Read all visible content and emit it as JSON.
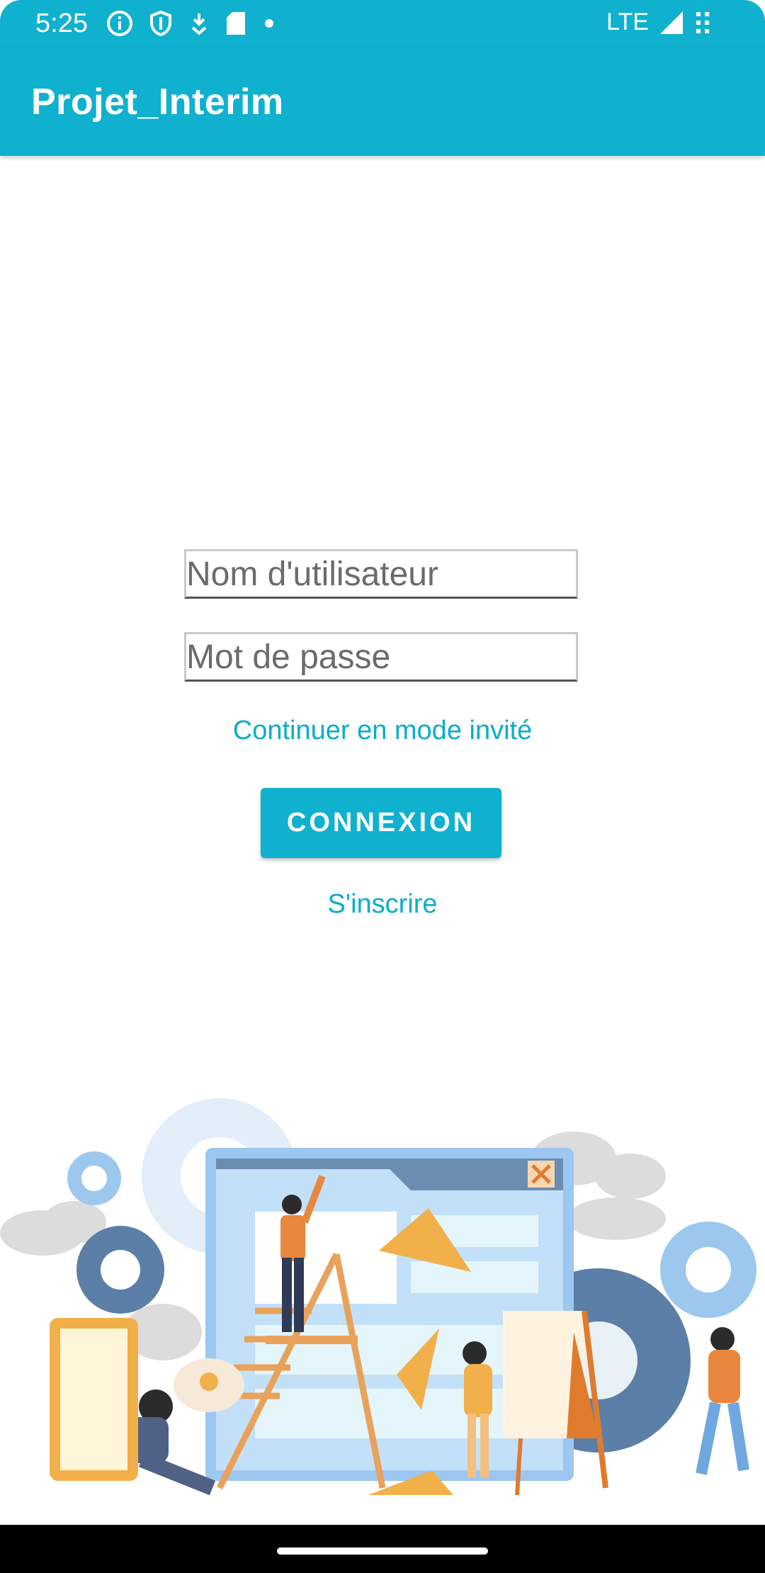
{
  "status_bar": {
    "time": "5:25",
    "network": "LTE",
    "icons": [
      "info-icon",
      "shield-icon",
      "download-icon",
      "sd-card-icon",
      "dot-icon",
      "signal-icon",
      "battery-icon"
    ]
  },
  "app_bar": {
    "title": "Projet_Interim"
  },
  "login": {
    "username_placeholder": "Nom d'utilisateur",
    "password_placeholder": "Mot de passe",
    "guest_link": "Continuer en mode invité",
    "connect_button": "CONNEXION",
    "signup_link": "S'inscrire"
  },
  "colors": {
    "primary": "#0fb1cf",
    "link": "#0aaccc",
    "nav_bar": "#000000"
  }
}
